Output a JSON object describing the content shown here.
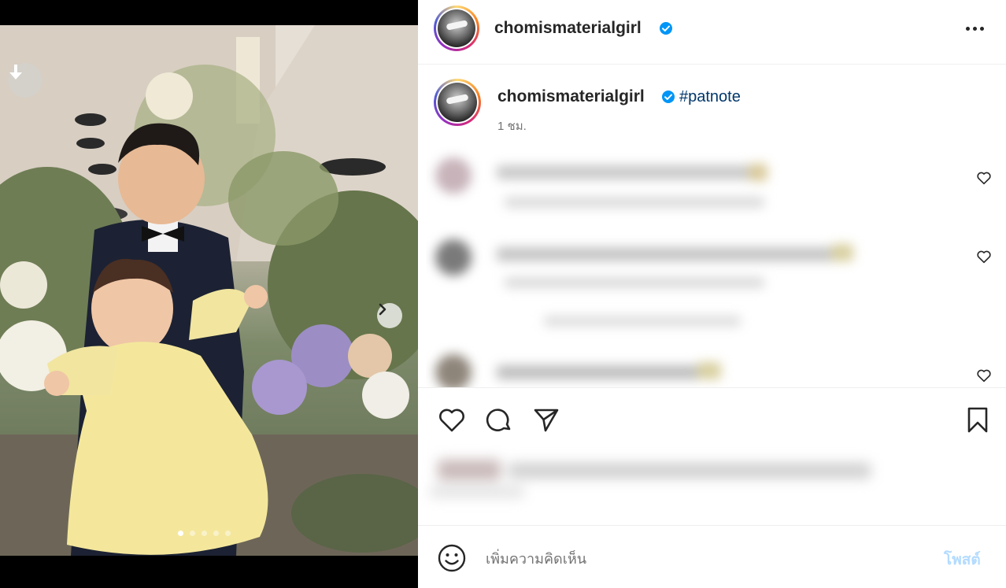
{
  "post": {
    "username": "chomismaterialgirl",
    "verified": true,
    "caption_hashtag": "#patnote",
    "timestamp": "1 ชม."
  },
  "icons": {
    "download": "download-icon",
    "next": "chevron-right-icon",
    "more": "more-horizontal-icon",
    "verified": "verified-badge-icon",
    "like": "heart-icon",
    "comment": "comment-bubble-icon",
    "share": "paper-plane-icon",
    "save": "bookmark-icon",
    "emoji": "smiley-icon"
  },
  "carousel": {
    "count": 5,
    "active_index": 0
  },
  "comments_count_visible": 3,
  "composer": {
    "placeholder": "เพิ่มความคิดเห็น",
    "post_label": "โพสต์"
  },
  "colors": {
    "hashtag": "#00376b",
    "verified": "#0095f6",
    "post_button_disabled": "#b3dbff",
    "meta_text": "#737373"
  }
}
